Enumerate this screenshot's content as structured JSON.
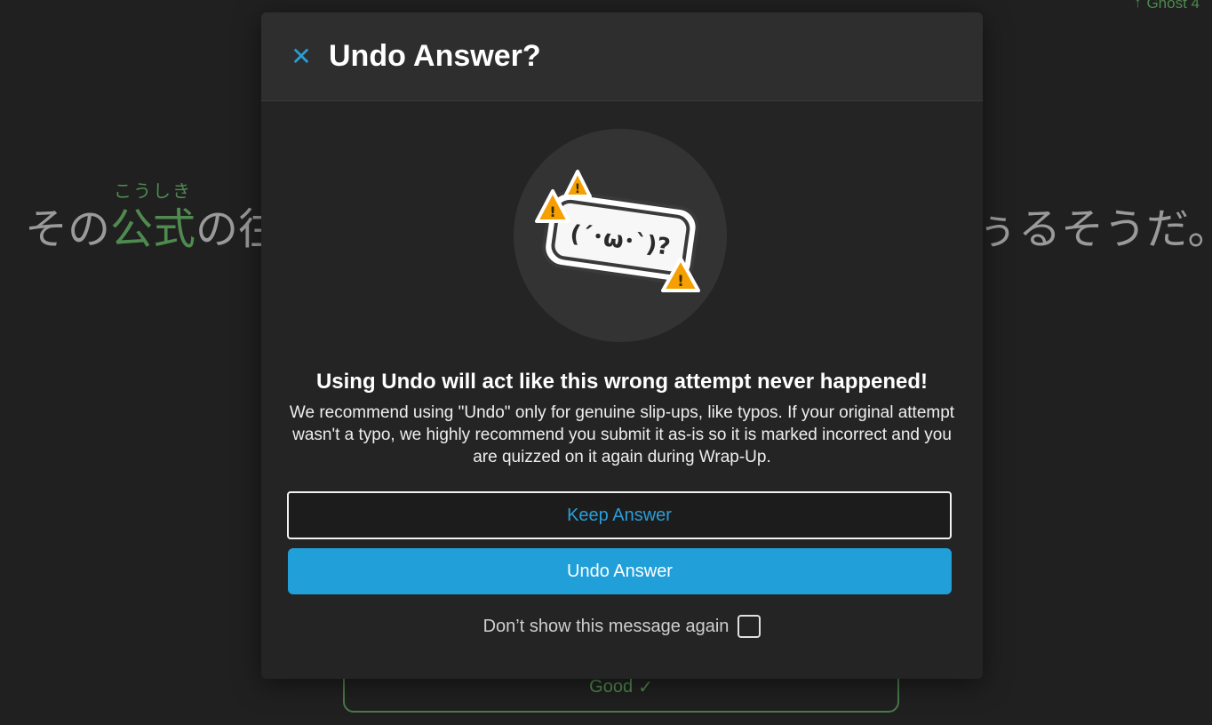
{
  "background": {
    "ghost_label": "Ghost 4",
    "ghost_icon": "ghost-arrow-icon",
    "sentence_prefix": "その",
    "keyword": "公式",
    "furigana": "こうしき",
    "sentence_mid": "の往",
    "sentence_suffix": "ぅるそうだ。",
    "grade_button_label": "Good",
    "grade_button_icon": "check-icon"
  },
  "modal": {
    "title": "Undo Answer?",
    "close_icon": "close-icon",
    "illustration_text": "(´･ω･`)?",
    "message_title": "Using Undo will act like this wrong attempt never happened!",
    "message_body": "We recommend using \"Undo\" only for genuine slip-ups, like typos. If your original attempt wasn't a typo, we highly recommend you submit it as-is so it is marked incorrect and you are quizzed on it again during Wrap-Up.",
    "keep_label": "Keep Answer",
    "undo_label": "Undo Answer",
    "dont_show_label": "Don’t show this message again",
    "dont_show_checked": false
  },
  "colors": {
    "accent": "#219fd8",
    "correct": "#4f8a4f",
    "warning": "#f5a000"
  }
}
